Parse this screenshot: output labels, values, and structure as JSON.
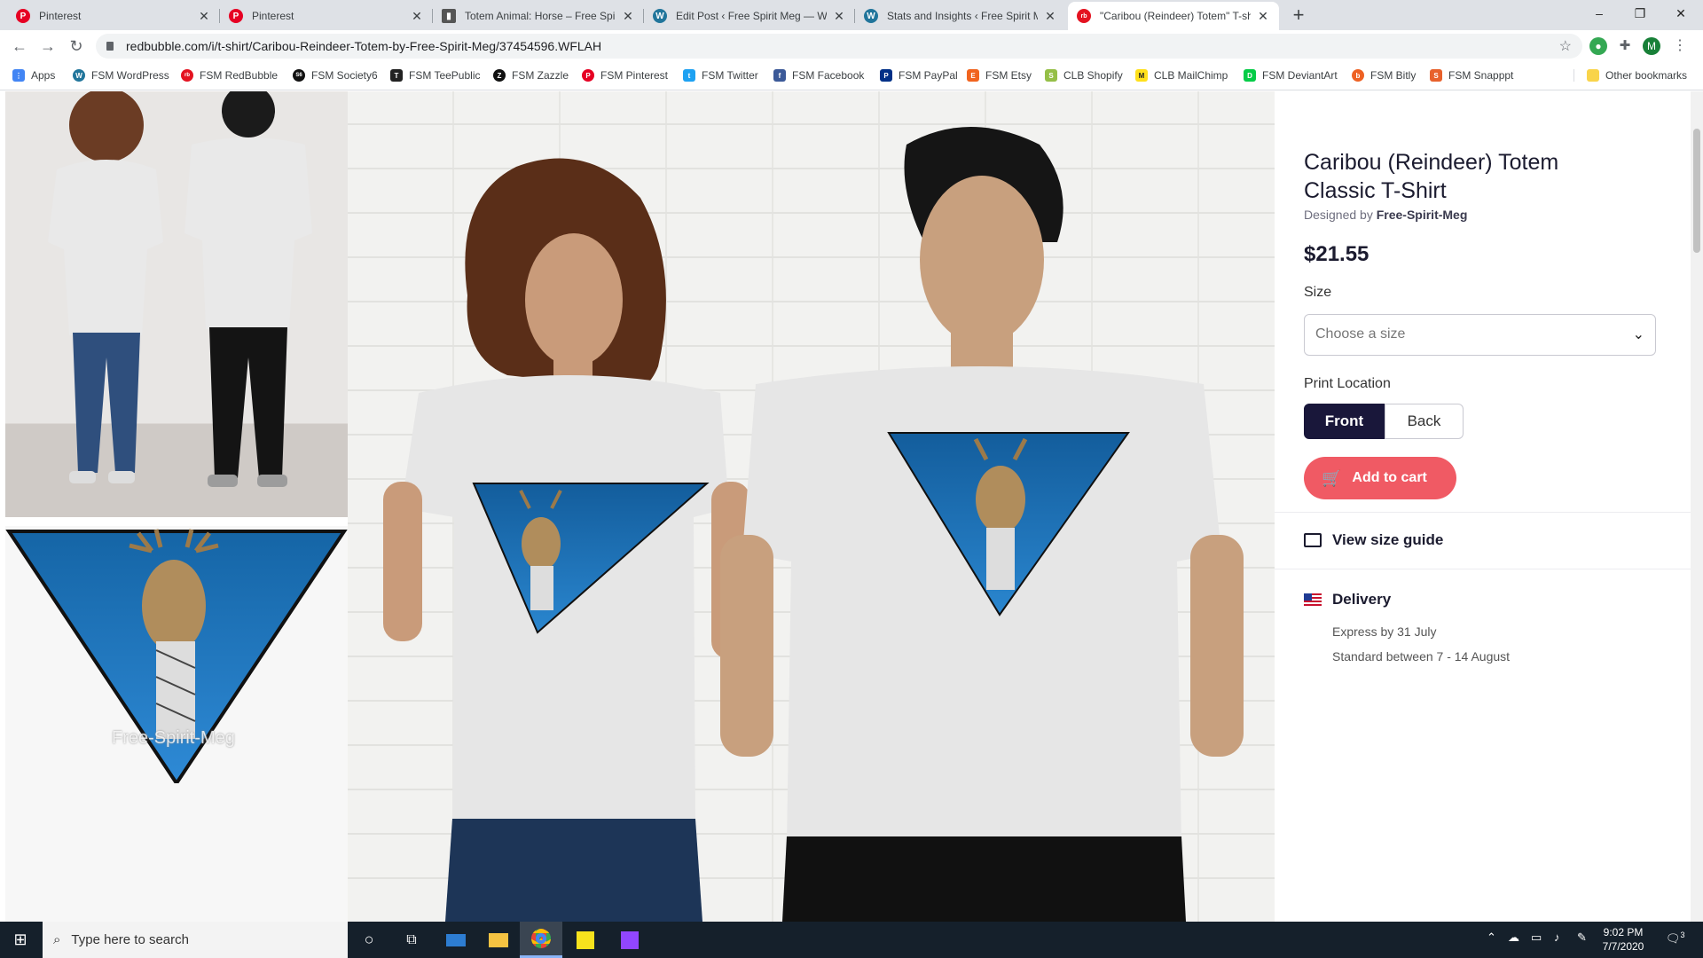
{
  "browser": {
    "tabs": [
      {
        "title": "Pinterest",
        "fav_color": "#e60023",
        "fav_glyph": "P"
      },
      {
        "title": "Pinterest",
        "fav_color": "#e60023",
        "fav_glyph": "P"
      },
      {
        "title": "Totem Animal: Horse – Free Spiri",
        "fav_color": "#555555",
        "fav_glyph": "▮"
      },
      {
        "title": "Edit Post ‹ Free Spirit Meg — Wo",
        "fav_color": "#21759b",
        "fav_glyph": "W"
      },
      {
        "title": "Stats and Insights ‹ Free Spirit Me",
        "fav_color": "#21759b",
        "fav_glyph": "W"
      },
      {
        "title": "\"Caribou (Reindeer) Totem\" T-sh",
        "fav_color": "#e41321",
        "fav_glyph": "rb"
      }
    ],
    "new_tab": "+",
    "window_controls": {
      "minimize": "–",
      "maximize": "❐",
      "close": "✕"
    },
    "url": "redbubble.com/i/t-shirt/Caribou-Reindeer-Totem-by-Free-Spirit-Meg/37454596.WFLAH",
    "profile_initial": "M",
    "bookmarks": [
      {
        "label": "Apps",
        "color": "#4285f4",
        "glyph": "⋮"
      },
      {
        "label": "FSM WordPress",
        "color": "#21759b",
        "glyph": "W"
      },
      {
        "label": "FSM RedBubble",
        "color": "#e41321",
        "glyph": "rb"
      },
      {
        "label": "FSM Society6",
        "color": "#111111",
        "glyph": "S6"
      },
      {
        "label": "FSM TeePublic",
        "color": "#222222",
        "glyph": "T"
      },
      {
        "label": "FSM Zazzle",
        "color": "#111111",
        "glyph": "Z"
      },
      {
        "label": "FSM Pinterest",
        "color": "#e60023",
        "glyph": "P"
      },
      {
        "label": "FSM Twitter",
        "color": "#1da1f2",
        "glyph": "t"
      },
      {
        "label": "FSM Facebook",
        "color": "#3b5998",
        "glyph": "f"
      },
      {
        "label": "FSM PayPal",
        "color": "#003087",
        "glyph": "P"
      },
      {
        "label": "FSM Etsy",
        "color": "#f1641e",
        "glyph": "E"
      },
      {
        "label": "CLB Shopify",
        "color": "#95bf47",
        "glyph": "S"
      },
      {
        "label": "CLB MailChimp",
        "color": "#ffe01b",
        "glyph": "M"
      },
      {
        "label": "FSM DeviantArt",
        "color": "#05cc47",
        "glyph": "D"
      },
      {
        "label": "FSM Bitly",
        "color": "#ee6123",
        "glyph": "b"
      },
      {
        "label": "FSM Snapppt",
        "color": "#e8612c",
        "glyph": "S"
      }
    ],
    "other_bookmarks": "Other bookmarks"
  },
  "gallery": {
    "watermark": "Free-Spirit-Meg"
  },
  "product": {
    "title": "Caribou (Reindeer) Totem Classic T-Shirt",
    "designed_by_prefix": "Designed by",
    "designer": "Free-Spirit-Meg",
    "price": "$21.55",
    "size_label": "Size",
    "size_placeholder": "Choose a size",
    "print_location_label": "Print Location",
    "print_options": [
      "Front",
      "Back"
    ],
    "selected_print": "Front",
    "add_to_cart": "Add to cart",
    "size_guide": "View size guide",
    "delivery_title": "Delivery",
    "delivery_express": "Express by 31 July",
    "delivery_standard": "Standard between 7 - 14 August"
  },
  "taskbar": {
    "search_placeholder": "Type here to search",
    "time": "9:02 PM",
    "date": "7/7/2020",
    "notification_count": "3"
  },
  "colors": {
    "accent_cart": "#f05a64",
    "selected_segment": "#19173a",
    "shirt_print_blue": "#1c6fb0"
  }
}
